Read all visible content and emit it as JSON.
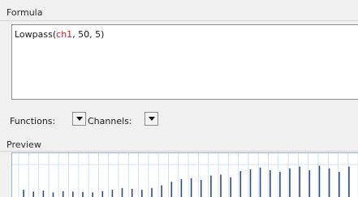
{
  "formula": {
    "group_title": "Formula",
    "expression": {
      "function": "Lowpass(",
      "channel_arg": "ch1",
      "rest": ", 50, 5)"
    }
  },
  "controls": {
    "functions_label": "Functions:",
    "channels_label": "Channels:"
  },
  "preview": {
    "group_title": "Preview",
    "spike_levels": [
      0.18,
      0.14,
      0.16,
      0.12,
      0.15,
      0.14,
      0.13,
      0.12,
      0.15,
      0.18,
      0.22,
      0.2,
      0.18,
      0.22,
      0.28,
      0.36,
      0.42,
      0.44,
      0.4,
      0.5,
      0.52,
      0.46,
      0.6,
      0.64,
      0.68,
      0.62,
      0.58,
      0.66,
      0.7,
      0.62,
      0.72,
      0.66,
      0.58,
      0.7
    ]
  },
  "colors": {
    "grid": "#cfe3ee",
    "spikes": "#2f4a86",
    "channel_arg": "#b8212a"
  }
}
